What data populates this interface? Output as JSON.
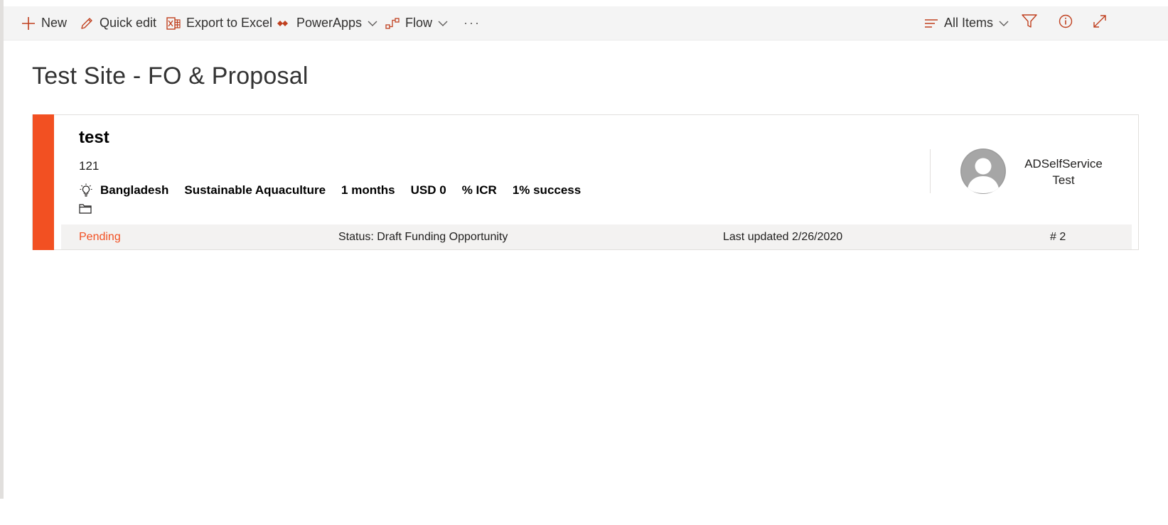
{
  "colors": {
    "accent": "#f25022",
    "icon": "#c0401f",
    "background": "#ffffff",
    "commandbar": "#f4f4f4"
  },
  "commandbar": {
    "new_label": "New",
    "quick_edit_label": "Quick edit",
    "export_label": "Export to Excel",
    "powerapps_label": "PowerApps",
    "flow_label": "Flow",
    "more_label": "···",
    "view_label": "All Items"
  },
  "page": {
    "title": "Test Site - FO & Proposal"
  },
  "card": {
    "title": "test",
    "number": "121",
    "country": "Bangladesh",
    "theme": "Sustainable Aquaculture",
    "duration": "1 months",
    "amount": "USD 0",
    "icr": "% ICR",
    "success": "1% success",
    "person_name": "ADSelfService",
    "person_surname": "Test",
    "footer": {
      "stage": "Pending",
      "status": "Status: Draft Funding Opportunity",
      "updated": "Last updated 2/26/2020",
      "id": "# 2"
    }
  }
}
